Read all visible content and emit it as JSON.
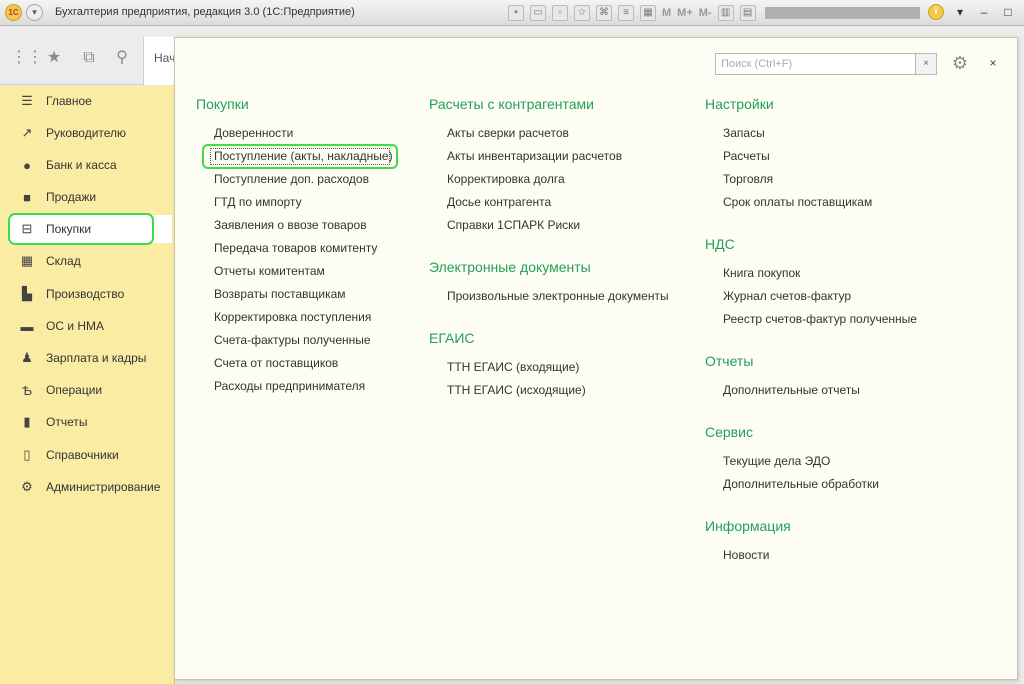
{
  "window": {
    "logo": "1С",
    "title": "Бухгалтерия предприятия, редакция 3.0  (1С:Предприятие)",
    "toolbar_text": [
      "M",
      "M+",
      "M-"
    ],
    "controls": [
      "i",
      "▾",
      "–",
      "□",
      "✕"
    ]
  },
  "nav_tab": {
    "label": "Нач"
  },
  "sidebar": {
    "items": [
      {
        "label": "Главное",
        "icon": "menu-icon"
      },
      {
        "label": "Руководителю",
        "icon": "trend-icon"
      },
      {
        "label": "Банк и касса",
        "icon": "coin-icon"
      },
      {
        "label": "Продажи",
        "icon": "bag-icon"
      },
      {
        "label": "Покупки",
        "icon": "cart-icon"
      },
      {
        "label": "Склад",
        "icon": "grid-icon"
      },
      {
        "label": "Производство",
        "icon": "factory-icon"
      },
      {
        "label": "ОС и НМА",
        "icon": "truck-icon"
      },
      {
        "label": "Зарплата и кадры",
        "icon": "person-icon"
      },
      {
        "label": "Операции",
        "icon": "operations-icon"
      },
      {
        "label": "Отчеты",
        "icon": "bar-chart-icon"
      },
      {
        "label": "Справочники",
        "icon": "book-icon"
      },
      {
        "label": "Администрирование",
        "icon": "gear-icon"
      }
    ]
  },
  "panel": {
    "search_placeholder": "Поиск (Ctrl+F)",
    "clear": "×",
    "close": "×",
    "groups": {
      "purchases": {
        "title": "Покупки",
        "links": [
          "Доверенности",
          "Поступление (акты, накладные)",
          "Поступление доп. расходов",
          "ГТД по импорту",
          "Заявления о ввозе товаров",
          "Передача товаров комитенту",
          "Отчеты комитентам",
          "Возвраты поставщикам",
          "Корректировка поступления",
          "Счета-фактуры полученные",
          "Счета от поставщиков",
          "Расходы предпринимателя"
        ]
      },
      "settlements": {
        "title": "Расчеты с контрагентами",
        "links": [
          "Акты сверки расчетов",
          "Акты инвентаризации расчетов",
          "Корректировка долга",
          "Досье контрагента",
          "Справки 1СПАРК Риски"
        ]
      },
      "edocs": {
        "title": "Электронные документы",
        "links": [
          "Произвольные электронные документы"
        ]
      },
      "egais": {
        "title": "ЕГАИС",
        "links": [
          "ТТН ЕГАИС (входящие)",
          "ТТН ЕГАИС (исходящие)"
        ]
      },
      "settings": {
        "title": "Настройки",
        "links": [
          "Запасы",
          "Расчеты",
          "Торговля",
          "Срок оплаты поставщикам"
        ]
      },
      "vat": {
        "title": "НДС",
        "links": [
          "Книга покупок",
          "Журнал счетов-фактур",
          "Реестр счетов-фактур полученные"
        ]
      },
      "reports": {
        "title": "Отчеты",
        "links": [
          "Дополнительные отчеты"
        ]
      },
      "service": {
        "title": "Сервис",
        "links": [
          "Текущие дела ЭДО",
          "Дополнительные обработки"
        ]
      },
      "info": {
        "title": "Информация",
        "links": [
          "Новости"
        ]
      }
    }
  },
  "colors": {
    "sidebar_bg": "#fbeca4",
    "group_title": "#23a05a",
    "highlight": "#3ddc48"
  }
}
